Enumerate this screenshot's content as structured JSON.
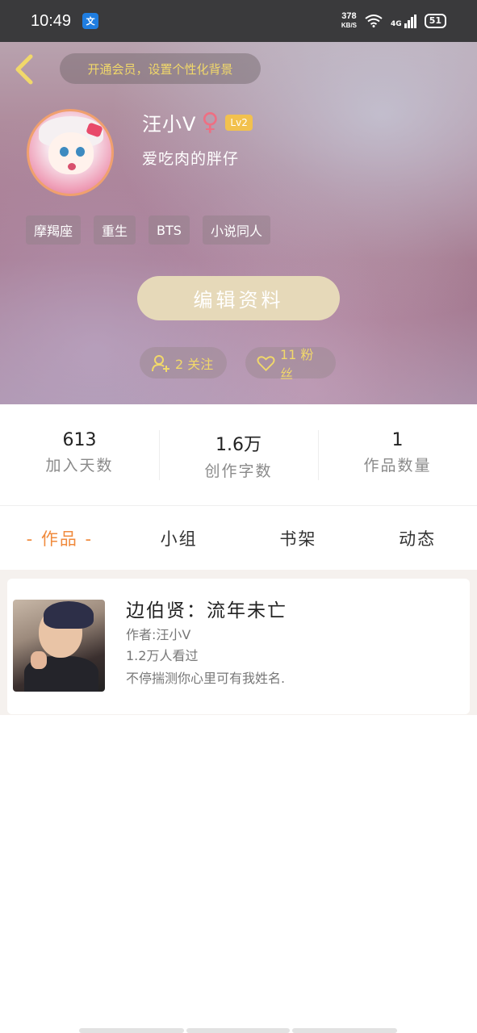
{
  "status_bar": {
    "time": "10:49",
    "app_icon": "文",
    "net_speed_value": "378",
    "net_speed_unit": "KB/S",
    "network": "4G",
    "battery": "51"
  },
  "header": {
    "vip_banner": "开通会员，设置个性化背景",
    "username": "汪小V",
    "gender_symbol": "♀",
    "level": "Lv2",
    "bio": "爱吃肉的胖仔",
    "tags": [
      "摩羯座",
      "重生",
      "BTS",
      "小说同人"
    ],
    "edit_button": "编辑资料",
    "follow_label": "2 关注",
    "fans_label": "11 粉丝"
  },
  "stats": [
    {
      "value": "613",
      "label": "加入天数"
    },
    {
      "value": "1.6万",
      "label": "创作字数"
    },
    {
      "value": "1",
      "label": "作品数量"
    }
  ],
  "tabs": [
    {
      "label": "- 作品 -",
      "active": true
    },
    {
      "label": "小组",
      "active": false
    },
    {
      "label": "书架",
      "active": false
    },
    {
      "label": "动态",
      "active": false
    }
  ],
  "works": [
    {
      "title": "边伯贤：流年未亡",
      "author": "作者:汪小V",
      "views": "1.2万人看过",
      "description": "不停揣测你心里可有我姓名."
    }
  ],
  "colors": {
    "accent": "#f08a3c",
    "vip_text": "#f1d86a",
    "level_badge": "#f2c14e",
    "edit_button": "#e6d9b9",
    "gender": "#ee6f83"
  }
}
